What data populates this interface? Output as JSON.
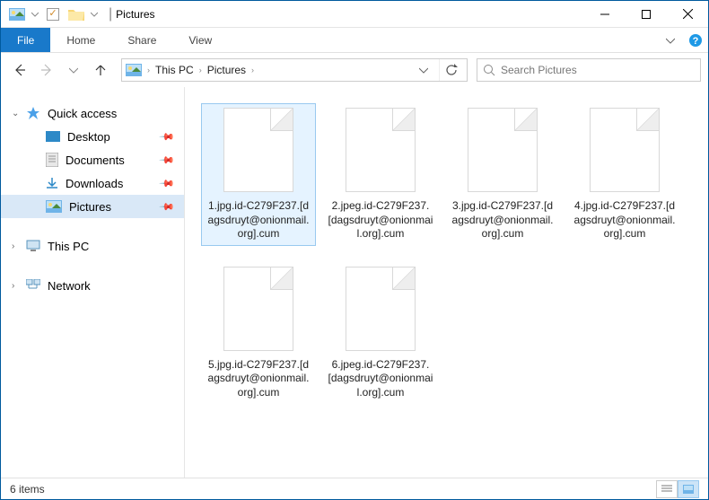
{
  "window": {
    "title": "Pictures",
    "separator": "|"
  },
  "ribbon": {
    "file": "File",
    "tabs": [
      "Home",
      "Share",
      "View"
    ]
  },
  "breadcrumb": {
    "items": [
      "This PC",
      "Pictures"
    ]
  },
  "search": {
    "placeholder": "Search Pictures"
  },
  "sidebar": {
    "quick_access": "Quick access",
    "items": [
      {
        "label": "Desktop",
        "pinned": true
      },
      {
        "label": "Documents",
        "pinned": true
      },
      {
        "label": "Downloads",
        "pinned": true
      },
      {
        "label": "Pictures",
        "pinned": true,
        "selected": true
      }
    ],
    "this_pc": "This PC",
    "network": "Network"
  },
  "files": [
    {
      "name": "1.jpg.id-C279F237.[dagsdruyt@onionmail.org].cum",
      "selected": true
    },
    {
      "name": "2.jpeg.id-C279F237.[dagsdruyt@onionmail.org].cum"
    },
    {
      "name": "3.jpg.id-C279F237.[dagsdruyt@onionmail.org].cum"
    },
    {
      "name": "4.jpg.id-C279F237.[dagsdruyt@onionmail.org].cum"
    },
    {
      "name": "5.jpg.id-C279F237.[dagsdruyt@onionmail.org].cum"
    },
    {
      "name": "6.jpeg.id-C279F237.[dagsdruyt@onionmail.org].cum"
    }
  ],
  "statusbar": {
    "count_label": "6 items"
  }
}
